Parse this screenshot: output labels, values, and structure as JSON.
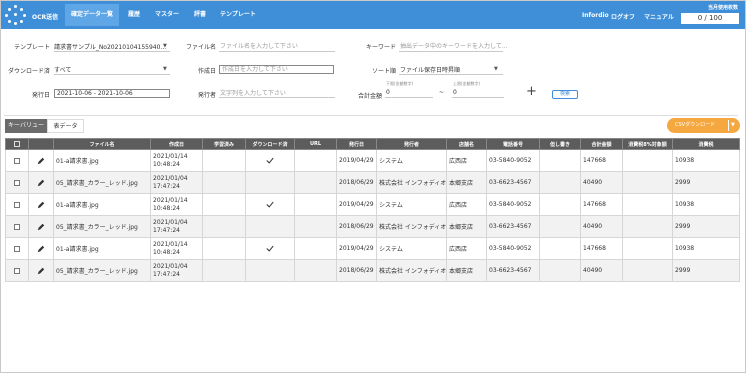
{
  "header": {
    "brand": "OCR送信",
    "nav": [
      "確定データ一覧",
      "履歴",
      "マスター",
      "評書",
      "テンプレート"
    ],
    "active_nav": 0,
    "links": [
      "Infordio",
      "ログオフ",
      "マニュアル"
    ],
    "usage_label": "当月使用枚数",
    "usage_value": "0 / 100"
  },
  "filters": {
    "template_label": "テンプレート",
    "template_value": "請求書サンプル_No20210104155940...",
    "filename_label": "ファイル名",
    "filename_placeholder": "ファイル名を入力して下さい",
    "keyword_label": "キーワード",
    "keyword_placeholder": "抽出データ中のキーワードを入力して...",
    "download_label": "ダウンロード済",
    "download_value": "すべて",
    "creator_label": "作成日",
    "creator_placeholder": "作成日を入力して下さい",
    "sort_label": "ソート順",
    "sort_value": "ファイル保存日時昇順",
    "issue_date_label": "発行日",
    "issue_date_value": "2021-10-06 - 2021-10-06",
    "issuer_label": "発行者",
    "issuer_placeholder": "文字列を入力して下さい",
    "amount_label": "合計金額",
    "amount_min_caption": "下限(金額数字)",
    "amount_min": "0",
    "amount_tilde": "~",
    "amount_max_caption": "上限(金額数字)",
    "amount_max": "0",
    "plus": "+",
    "search_button": "検索"
  },
  "tabs": [
    "キーバリュー",
    "表データ"
  ],
  "active_tab": 0,
  "csv_button": "CSVダウンロード",
  "csv_caret": "▼",
  "table": {
    "columns": [
      "",
      "",
      "ファイル名",
      "作成日",
      "学習済み",
      "ダウンロード済",
      "URL",
      "発行日",
      "発行者",
      "店舗名",
      "電話番号",
      "但し書き",
      "合計金額",
      "消費税8%対象額",
      "消費税"
    ],
    "rows": [
      {
        "file": "01-a請求書.jpg",
        "created": "2021/01/14",
        "created_time": "10:48:24",
        "learned": "",
        "downloaded": "✓",
        "url": "",
        "issued": "2019/04/29",
        "issuer": "システム",
        "store": "広西店",
        "phone": "03-5840-9052",
        "note": "",
        "total": "147668",
        "tax8": "",
        "tax": "10938"
      },
      {
        "file": "05_請求書_カラー_レッド.jpg",
        "created": "2021/01/04",
        "created_time": "17:47:24",
        "learned": "",
        "downloaded": "",
        "url": "",
        "issued": "2018/06/29",
        "issuer": "株式会社 インフォディオ 部中",
        "store": "本郷支店",
        "phone": "03-6623-4567",
        "note": "",
        "total": "40490",
        "tax8": "",
        "tax": "2999"
      },
      {
        "file": "01-a請求書.jpg",
        "created": "2021/01/14",
        "created_time": "10:48:24",
        "learned": "",
        "downloaded": "✓",
        "url": "",
        "issued": "2019/04/29",
        "issuer": "システム",
        "store": "広西店",
        "phone": "03-5840-9052",
        "note": "",
        "total": "147668",
        "tax8": "",
        "tax": "10938"
      },
      {
        "file": "05_請求書_カラー_レッド.jpg",
        "created": "2021/01/04",
        "created_time": "17:47:24",
        "learned": "",
        "downloaded": "",
        "url": "",
        "issued": "2018/06/29",
        "issuer": "株式会社 インフォディオ 部中",
        "store": "本郷支店",
        "phone": "03-6623-4567",
        "note": "",
        "total": "40490",
        "tax8": "",
        "tax": "2999"
      },
      {
        "file": "01-a請求書.jpg",
        "created": "2021/01/14",
        "created_time": "10:48:24",
        "learned": "",
        "downloaded": "✓",
        "url": "",
        "issued": "2019/04/29",
        "issuer": "システム",
        "store": "広西店",
        "phone": "03-5840-9052",
        "note": "",
        "total": "147668",
        "tax8": "",
        "tax": "10938"
      },
      {
        "file": "05_請求書_カラー_レッド.jpg",
        "created": "2021/01/04",
        "created_time": "17:47:24",
        "learned": "",
        "downloaded": "",
        "url": "",
        "issued": "2018/06/29",
        "issuer": "株式会社 インフォディオ 部中",
        "store": "本郷支店",
        "phone": "03-6623-4567",
        "note": "",
        "total": "40490",
        "tax8": "",
        "tax": "2999"
      }
    ]
  },
  "colors": {
    "header_bg": "#3f8fd8",
    "accent": "#f5a840",
    "table_header": "#5c5c5c"
  },
  "icons": [
    "logo-icon",
    "caret-down-icon",
    "plus-icon",
    "pen-icon",
    "checkmark-icon",
    "checkbox-icon"
  ]
}
